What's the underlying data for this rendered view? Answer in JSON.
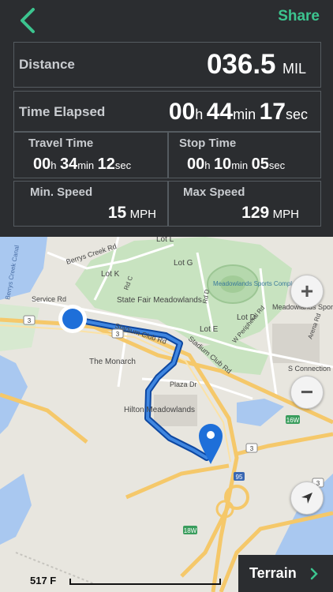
{
  "header": {
    "share_label": "Share"
  },
  "stats": {
    "distance": {
      "label": "Distance",
      "value": "036.5",
      "unit": "MIL"
    },
    "time_elapsed": {
      "label": "Time Elapsed",
      "h": "00",
      "h_unit": "h",
      "m": "44",
      "m_unit": "min",
      "s": "17",
      "s_unit": "sec"
    },
    "travel_time": {
      "label": "Travel Time",
      "h": "00",
      "h_unit": "h",
      "m": "34",
      "m_unit": "min",
      "s": "12",
      "s_unit": "sec"
    },
    "stop_time": {
      "label": "Stop Time",
      "h": "00",
      "h_unit": "h",
      "m": "10",
      "m_unit": "min",
      "s": "05",
      "s_unit": "sec"
    },
    "min_speed": {
      "label": "Min. Speed",
      "value": "15",
      "unit": "MPH"
    },
    "max_speed": {
      "label": "Max Speed",
      "value": "129",
      "unit": "MPH"
    }
  },
  "map": {
    "labels": {
      "lot_l": "Lot L",
      "lot_g": "Lot G",
      "lot_k": "Lot K",
      "lot_e": "Lot E",
      "lot_d": "Lot D",
      "berrys_creek_rd": "Berrys Creek Rd",
      "state_fair": "State Fair Meadowlands",
      "meadowlands_sports": "Meadowlands Sports Complex",
      "meadowlands_sports_2": "Meadowlands Sports Complex",
      "service_rd": "Service Rd",
      "stadium_club_rd": "Stadium Club Rd",
      "stadium_club_rd_2": "Stadium Club Rd",
      "the_monarch": "The Monarch",
      "plaza_dr": "Plaza Dr",
      "hilton": "Hilton Meadowlands",
      "rd_c": "Rd C",
      "rd_d": "Rd D",
      "w_peripheral": "W Peripheral Rd",
      "s_connection": "S Connection Rd",
      "arena_rd": "Arena Rd",
      "berrys_creek_canal": "Berrys Creek Canal",
      "route_3a": "3",
      "route_3b": "3",
      "route_3c": "3",
      "route_3d": "3",
      "route_16w": "16W",
      "route_18w": "18W",
      "route_95": "95"
    },
    "zoom_in": "+",
    "zoom_out": "−",
    "scale_text": "517 F",
    "terrain_label": "Terrain"
  },
  "colors": {
    "accent": "#3cc48f",
    "route": "#1565c0",
    "pin": "#1e6fd9",
    "background": "#2b2d30"
  }
}
